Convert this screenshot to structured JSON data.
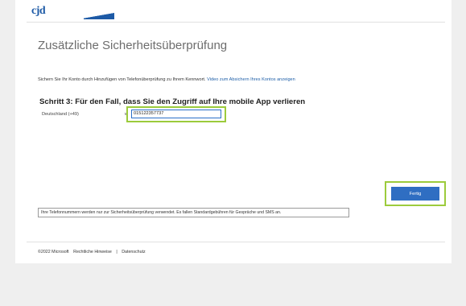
{
  "logo": {
    "text": "cjd",
    "subtext": ""
  },
  "page_title": "Zusätzliche Sicherheitsüberprüfung",
  "intro": {
    "text": "Sichern Sie Ihr Konto durch Hinzufügen von Telefonüberprüfung zu Ihrem Kennwort.",
    "link": "Video zum Absichern Ihres Kontos anzeigen"
  },
  "step_heading": "Schritt 3: Für den Fall, dass Sie den Zugriff auf Ihre mobile App verlieren",
  "country_select": {
    "value": "Deutschland (+49)"
  },
  "phone_input": {
    "value": "015122357737"
  },
  "finish_button": "Fertig",
  "notice": "Ihre Telefonnummern werden nur zur Sicherheitsüberprüfung verwendet. Es fallen Standardgebühren für Gespräche und SMS an.",
  "footer": {
    "copyright": "©2022 Microsoft",
    "legal": "Rechtliche Hinweise",
    "separator": "|",
    "privacy": "Datenschutz"
  },
  "colors": {
    "accent": "#2f6ec2",
    "highlight": "#9ccb3c",
    "link": "#1f5fa8",
    "logo": "#1d5aa6"
  }
}
